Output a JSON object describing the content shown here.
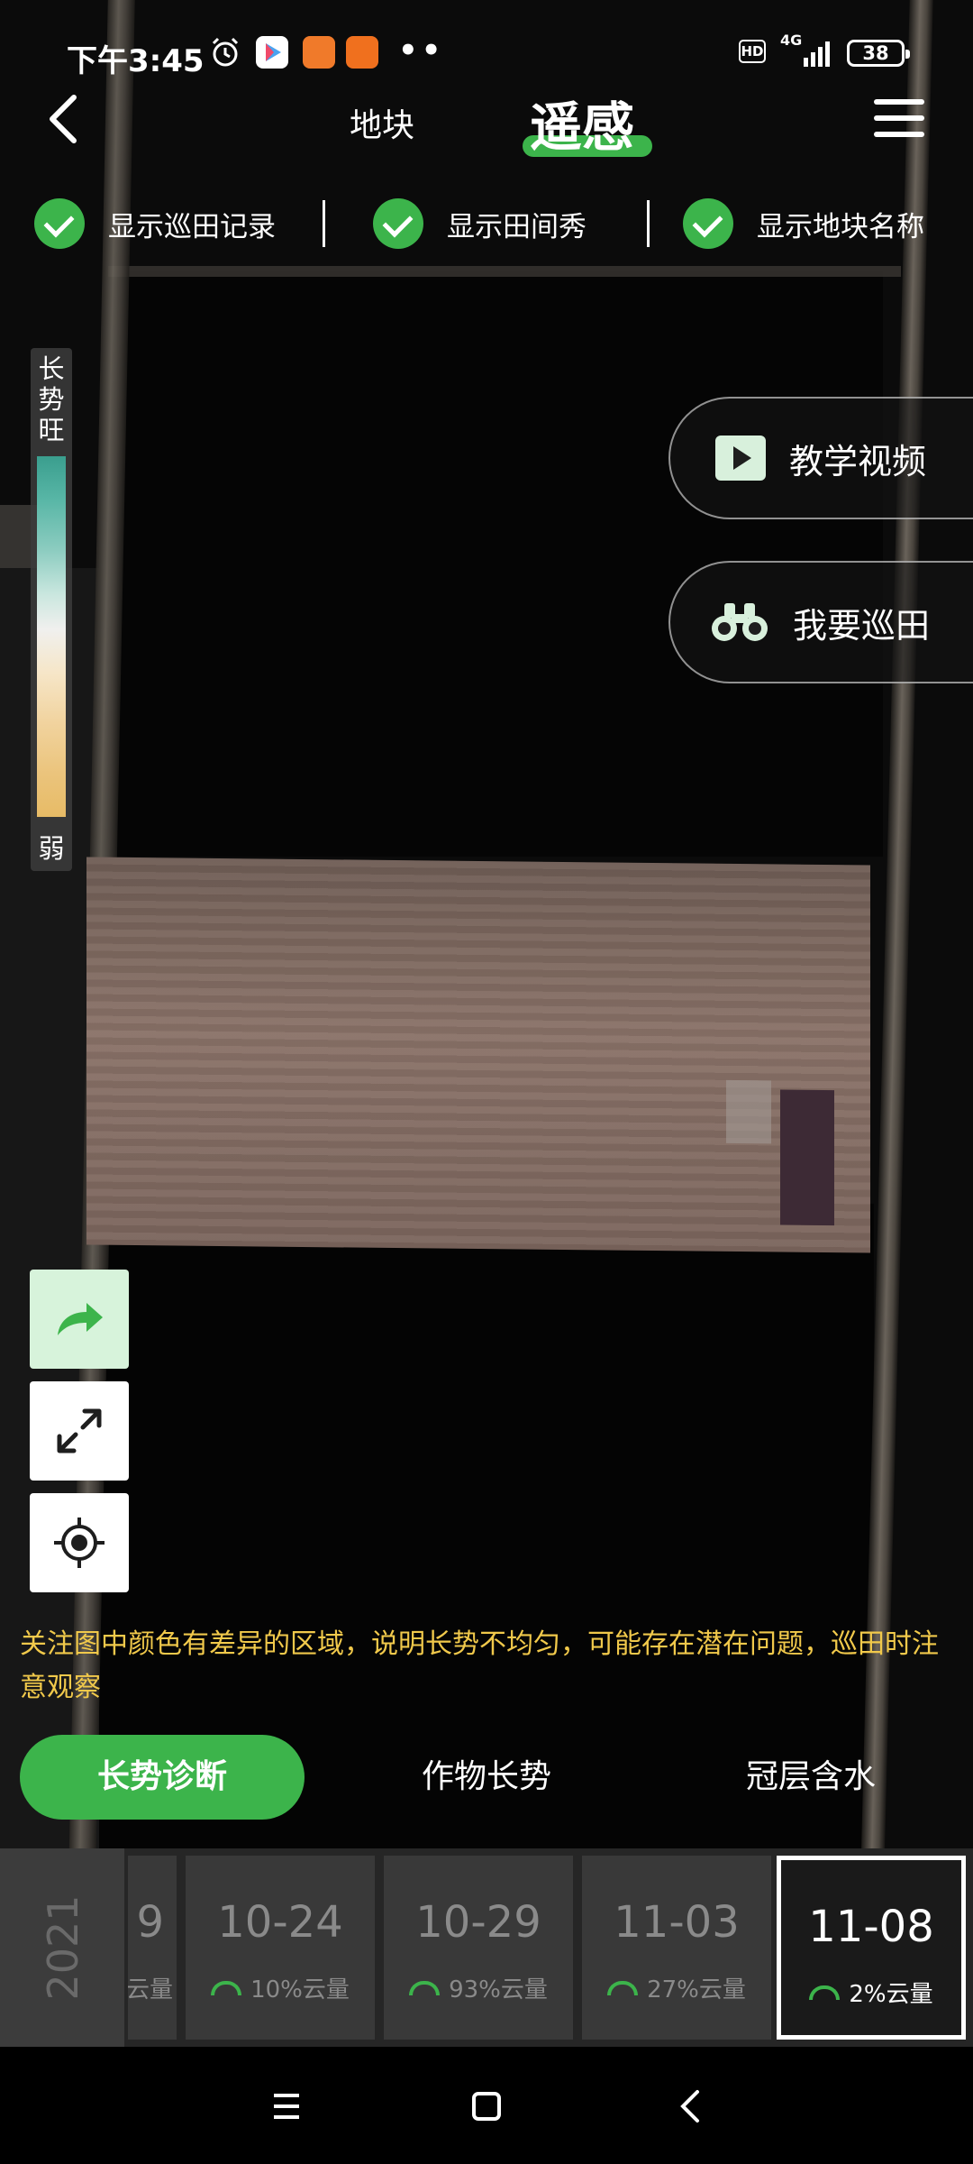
{
  "status_bar": {
    "time": "下午3:45",
    "dots": "••",
    "hd": "HD",
    "network": "4G",
    "battery": "38",
    "icons": [
      "alarm-icon",
      "video-app-icon",
      "shop-app-icon",
      "taobao-app-icon"
    ]
  },
  "nav": {
    "tab_plot": "地块",
    "tab_remote": "遥感",
    "accent": "#3cb44b"
  },
  "toggles": [
    {
      "label": "显示巡田记录",
      "checked": true
    },
    {
      "label": "显示田间秀",
      "checked": true
    },
    {
      "label": "显示地块名称",
      "checked": true
    }
  ],
  "legend": {
    "top": [
      "长",
      "势",
      "旺"
    ],
    "bottom": "弱"
  },
  "actions": {
    "tutorial": "教学视频",
    "patrol": "我要巡田"
  },
  "tools": [
    "share-icon",
    "fullscreen-icon",
    "locate-icon"
  ],
  "tip": "关注图中颜色有差异的区域，说明长势不均匀，可能存在潜在问题，巡田时注意观察",
  "modes": [
    {
      "label": "长势诊断",
      "active": true
    },
    {
      "label": "作物长势",
      "active": false
    },
    {
      "label": "冠层含水",
      "active": false
    }
  ],
  "timeline": {
    "year": "2021",
    "partial": {
      "date": "9",
      "cloud": "云量"
    },
    "dates": [
      {
        "date": "10-24",
        "cloud": "10%云量",
        "selected": false
      },
      {
        "date": "10-29",
        "cloud": "93%云量",
        "selected": false
      },
      {
        "date": "11-03",
        "cloud": "27%云量",
        "selected": false
      },
      {
        "date": "11-08",
        "cloud": "2%云量",
        "selected": true
      }
    ]
  }
}
